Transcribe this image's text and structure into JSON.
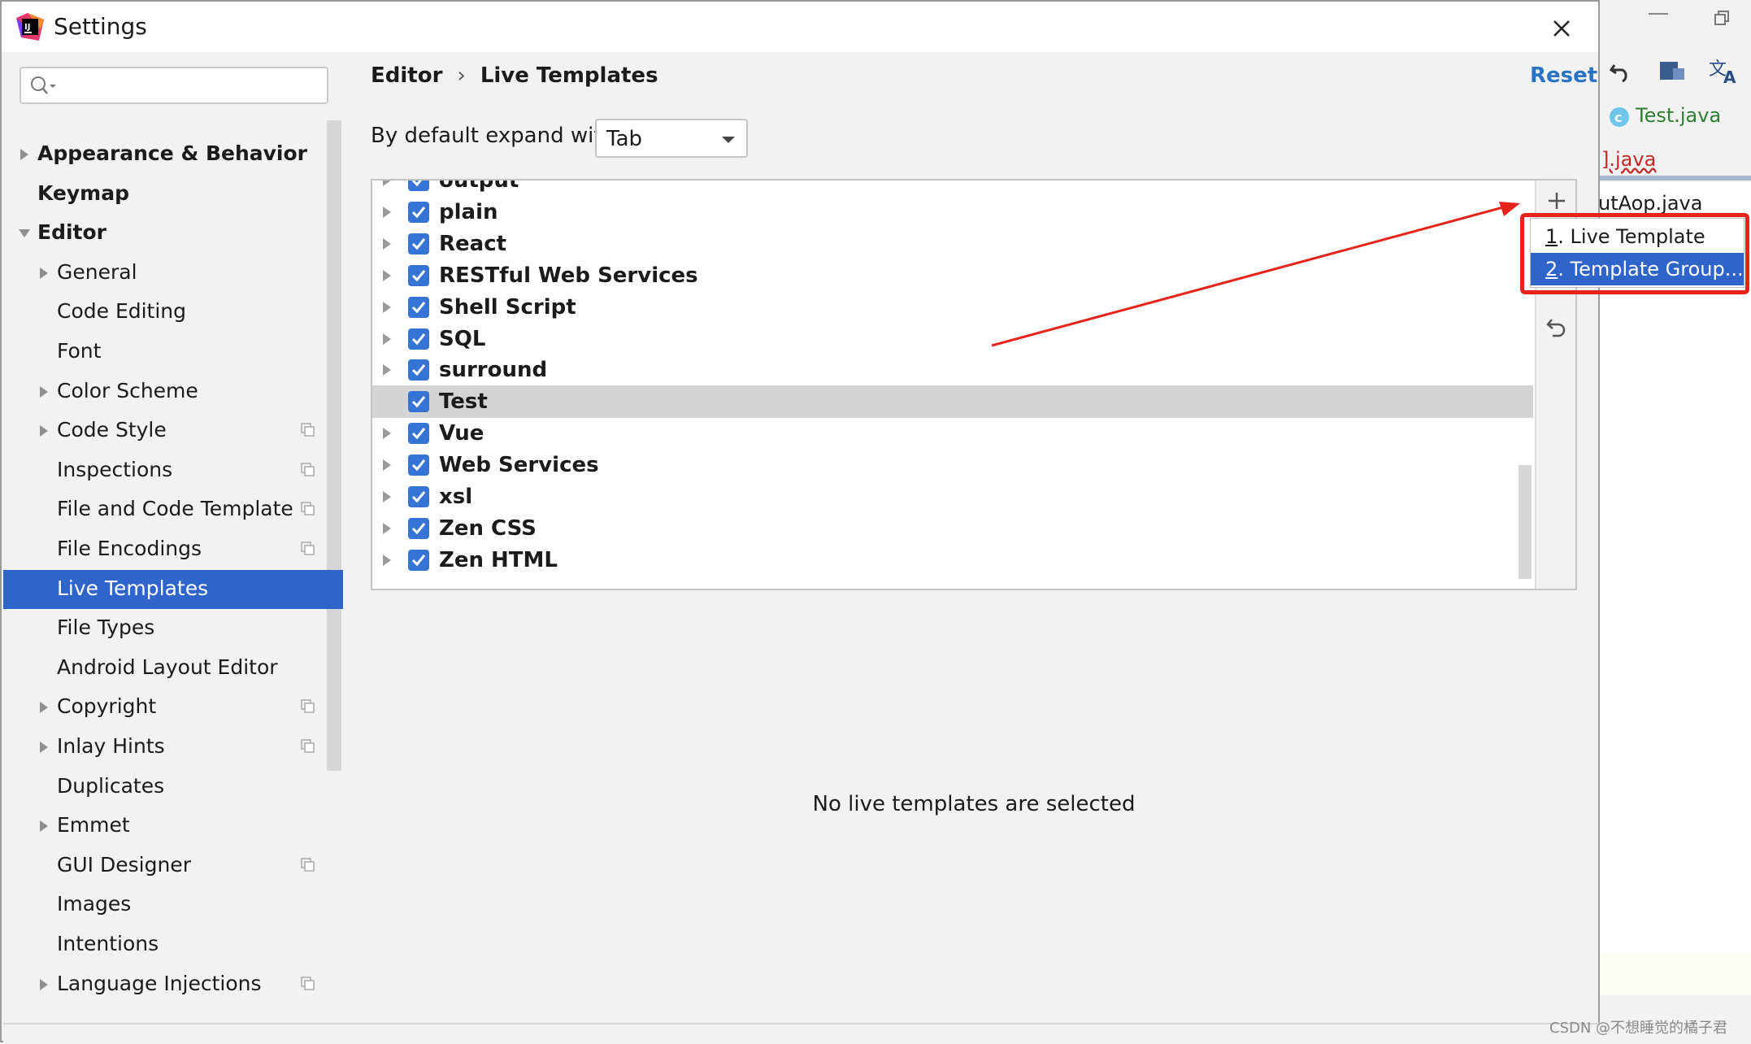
{
  "window": {
    "title": "Settings"
  },
  "search": {
    "placeholder": "",
    "value": ""
  },
  "sidebar": {
    "items": [
      {
        "label": "Appearance & Behavior",
        "bold": true,
        "expandable": true,
        "expanded": false,
        "level": 0,
        "copy": false
      },
      {
        "label": "Keymap",
        "bold": true,
        "expandable": false,
        "level": 0,
        "copy": false
      },
      {
        "label": "Editor",
        "bold": true,
        "expandable": true,
        "expanded": true,
        "level": 0,
        "copy": false
      },
      {
        "label": "General",
        "bold": false,
        "expandable": true,
        "expanded": false,
        "level": 1,
        "copy": false
      },
      {
        "label": "Code Editing",
        "bold": false,
        "expandable": false,
        "level": 1,
        "copy": false
      },
      {
        "label": "Font",
        "bold": false,
        "expandable": false,
        "level": 1,
        "copy": false
      },
      {
        "label": "Color Scheme",
        "bold": false,
        "expandable": true,
        "expanded": false,
        "level": 1,
        "copy": false
      },
      {
        "label": "Code Style",
        "bold": false,
        "expandable": true,
        "expanded": false,
        "level": 1,
        "copy": true
      },
      {
        "label": "Inspections",
        "bold": false,
        "expandable": false,
        "level": 1,
        "copy": true
      },
      {
        "label": "File and Code Template",
        "bold": false,
        "expandable": false,
        "level": 1,
        "copy": true
      },
      {
        "label": "File Encodings",
        "bold": false,
        "expandable": false,
        "level": 1,
        "copy": true
      },
      {
        "label": "Live Templates",
        "bold": false,
        "expandable": false,
        "level": 1,
        "copy": false,
        "selected": true
      },
      {
        "label": "File Types",
        "bold": false,
        "expandable": false,
        "level": 1,
        "copy": false
      },
      {
        "label": "Android Layout Editor",
        "bold": false,
        "expandable": false,
        "level": 1,
        "copy": false
      },
      {
        "label": "Copyright",
        "bold": false,
        "expandable": true,
        "expanded": false,
        "level": 1,
        "copy": true
      },
      {
        "label": "Inlay Hints",
        "bold": false,
        "expandable": true,
        "expanded": false,
        "level": 1,
        "copy": true
      },
      {
        "label": "Duplicates",
        "bold": false,
        "expandable": false,
        "level": 1,
        "copy": false
      },
      {
        "label": "Emmet",
        "bold": false,
        "expandable": true,
        "expanded": false,
        "level": 1,
        "copy": false
      },
      {
        "label": "GUI Designer",
        "bold": false,
        "expandable": false,
        "level": 1,
        "copy": true
      },
      {
        "label": "Images",
        "bold": false,
        "expandable": false,
        "level": 1,
        "copy": false
      },
      {
        "label": "Intentions",
        "bold": false,
        "expandable": false,
        "level": 1,
        "copy": false
      },
      {
        "label": "Language Injections",
        "bold": false,
        "expandable": true,
        "expanded": false,
        "level": 1,
        "copy": true
      }
    ]
  },
  "main": {
    "breadcrumb": [
      "Editor",
      "Live Templates"
    ],
    "breadcrumb_separator": "›",
    "reset_label": "Reset",
    "expand_label": "By default expand with",
    "expand_value": "Tab",
    "template_groups": [
      {
        "label": "output",
        "checked": true,
        "selected": false
      },
      {
        "label": "plain",
        "checked": true,
        "selected": false
      },
      {
        "label": "React",
        "checked": true,
        "selected": false
      },
      {
        "label": "RESTful Web Services",
        "checked": true,
        "selected": false
      },
      {
        "label": "Shell Script",
        "checked": true,
        "selected": false
      },
      {
        "label": "SQL",
        "checked": true,
        "selected": false
      },
      {
        "label": "surround",
        "checked": true,
        "selected": false
      },
      {
        "label": "Test",
        "checked": true,
        "selected": true
      },
      {
        "label": "Vue",
        "checked": true,
        "selected": false
      },
      {
        "label": "Web Services",
        "checked": true,
        "selected": false
      },
      {
        "label": "xsl",
        "checked": true,
        "selected": false
      },
      {
        "label": "Zen CSS",
        "checked": true,
        "selected": false
      },
      {
        "label": "Zen HTML",
        "checked": true,
        "selected": false
      }
    ],
    "empty_message": "No live templates are selected"
  },
  "popup_menu": {
    "items": [
      {
        "mnemonic": "1",
        "label": ". Live Template",
        "selected": false
      },
      {
        "mnemonic": "2",
        "label": ". Template Group...",
        "selected": true
      }
    ]
  },
  "editor_background": {
    "files": [
      "Test.java",
      "].java",
      "utAop.java"
    ]
  },
  "watermark": "CSDN @不想睡觉的橘子君",
  "colors": {
    "selection": "#2f65ca",
    "checkbox": "#3574d4",
    "link": "#2873c6",
    "annotation": "#e8231b"
  },
  "icons": {
    "app": "intellij-icon",
    "close": "close-icon",
    "search": "search-icon",
    "add": "plus-icon",
    "revert": "undo-icon",
    "copy": "project-settings-icon",
    "expand": "chevron-right-icon"
  }
}
